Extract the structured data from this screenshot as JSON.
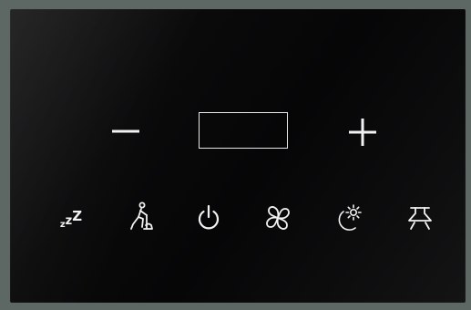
{
  "panel": {
    "display_value": "",
    "controls": [
      {
        "id": "minus",
        "icon": "minus-icon"
      },
      {
        "id": "plus",
        "icon": "plus-icon"
      },
      {
        "id": "sleep",
        "icon": "sleep-zzz-icon",
        "glyphs": [
          "z",
          "z",
          "Z"
        ]
      },
      {
        "id": "cleaning",
        "icon": "cleaning-person-icon"
      },
      {
        "id": "power",
        "icon": "power-icon"
      },
      {
        "id": "fan",
        "icon": "fan-icon"
      },
      {
        "id": "night-mode",
        "icon": "moon-sun-icon"
      },
      {
        "id": "hood-light",
        "icon": "hood-light-icon"
      }
    ],
    "icon_color": "#f2f2f2",
    "panel_color": "#0a0a0b",
    "frame_color": "#5d6764"
  }
}
